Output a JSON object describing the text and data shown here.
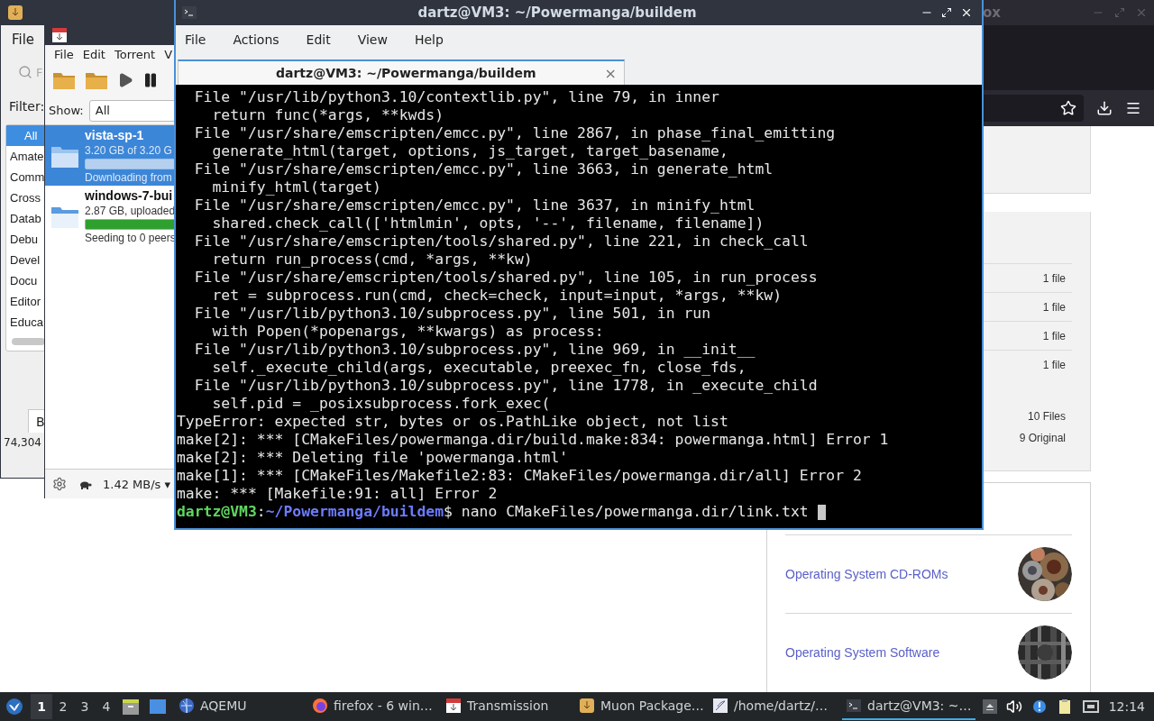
{
  "firefox": {
    "title": "ox",
    "file_counts": [
      "1 file",
      "1 file",
      "1 file",
      "1 file"
    ],
    "totals": [
      "10 Files",
      "9 Original"
    ],
    "collections": [
      {
        "label": "Operating System CD-ROMs",
        "kind": "picture"
      },
      {
        "label": "Operating System Software",
        "kind": "picture"
      }
    ]
  },
  "muon": {
    "menu": [
      "File"
    ],
    "search": {
      "placeholder": "F"
    },
    "filter_label": "Filter:",
    "categories": [
      {
        "label": "All",
        "selected": true
      },
      {
        "label": "Amate",
        "selected": false
      },
      {
        "label": "Comm",
        "selected": false
      },
      {
        "label": "Cross",
        "selected": false
      },
      {
        "label": "Datab",
        "selected": false
      },
      {
        "label": "Debu",
        "selected": false
      },
      {
        "label": "Devel",
        "selected": false
      },
      {
        "label": "Docu",
        "selected": false
      },
      {
        "label": "Editor",
        "selected": false
      },
      {
        "label": "Educa",
        "selected": false
      }
    ],
    "bottom_tab": "B",
    "status": "74,304"
  },
  "transmission": {
    "menu": [
      "File",
      "Edit",
      "Torrent",
      "V"
    ],
    "show_label": "Show:",
    "show_value": "All",
    "torrents": [
      {
        "name": "vista-sp-1",
        "size": "3.20 GB of 3.20 G",
        "level": 1,
        "status": "Downloading from",
        "kind": "downloading",
        "selected": true
      },
      {
        "name": "windows-7-bui",
        "size": "2.87 GB, uploaded",
        "level": 1,
        "status": "Seeding to 0 peers",
        "kind": "seeding",
        "selected": false
      }
    ],
    "speed": "1.42 MB/s ▾"
  },
  "terminal": {
    "title": "dartz@VM3: ~/Powermanga/buildem",
    "menu": [
      "File",
      "Actions",
      "Edit",
      "View",
      "Help"
    ],
    "tab_title": "dartz@VM3: ~/Powermanga/buildem",
    "tab_close": "×",
    "lines": [
      "  File \"/usr/lib/python3.10/contextlib.py\", line 79, in inner",
      "    return func(*args, **kwds)",
      "  File \"/usr/share/emscripten/emcc.py\", line 2867, in phase_final_emitting",
      "    generate_html(target, options, js_target, target_basename,",
      "  File \"/usr/share/emscripten/emcc.py\", line 3663, in generate_html",
      "    minify_html(target)",
      "  File \"/usr/share/emscripten/emcc.py\", line 3637, in minify_html",
      "    shared.check_call(['htmlmin', opts, '--', filename, filename])",
      "  File \"/usr/share/emscripten/tools/shared.py\", line 221, in check_call",
      "    return run_process(cmd, *args, **kw)",
      "  File \"/usr/share/emscripten/tools/shared.py\", line 105, in run_process",
      "    ret = subprocess.run(cmd, check=check, input=input, *args, **kw)",
      "  File \"/usr/lib/python3.10/subprocess.py\", line 501, in run",
      "    with Popen(*popenargs, **kwargs) as process:",
      "  File \"/usr/lib/python3.10/subprocess.py\", line 969, in __init__",
      "    self._execute_child(args, executable, preexec_fn, close_fds,",
      "  File \"/usr/lib/python3.10/subprocess.py\", line 1778, in _execute_child",
      "    self.pid = _posixsubprocess.fork_exec(",
      "TypeError: expected str, bytes or os.PathLike object, not list",
      "make[2]: *** [CMakeFiles/powermanga.dir/build.make:834: powermanga.html] Error 1",
      "make[2]: *** Deleting file 'powermanga.html'",
      "make[1]: *** [CMakeFiles/Makefile2:83: CMakeFiles/powermanga.dir/all] Error 2",
      "make: *** [Makefile:91: all] Error 2"
    ],
    "prompt": {
      "user": "dartz@VM3",
      "separator": ":",
      "path": "~/Powermanga/buildem",
      "command": "$ nano CMakeFiles/powermanga.dir/link.txt"
    }
  },
  "taskbar": {
    "workspaces": [
      {
        "label": "1",
        "selected": true
      },
      {
        "label": "2",
        "selected": false
      },
      {
        "label": "3",
        "selected": false
      },
      {
        "label": "4",
        "selected": false
      }
    ],
    "tasks": [
      {
        "label": "AQEMU",
        "selected": false
      },
      {
        "label": "firefox - 6 win…",
        "selected": false
      },
      {
        "label": "Transmission",
        "selected": false
      },
      {
        "label": "Muon Package…",
        "selected": false
      },
      {
        "label": "/home/dartz/…",
        "selected": false
      },
      {
        "label": "dartz@VM3: ~…",
        "selected": true
      }
    ],
    "clock": "12:14"
  }
}
